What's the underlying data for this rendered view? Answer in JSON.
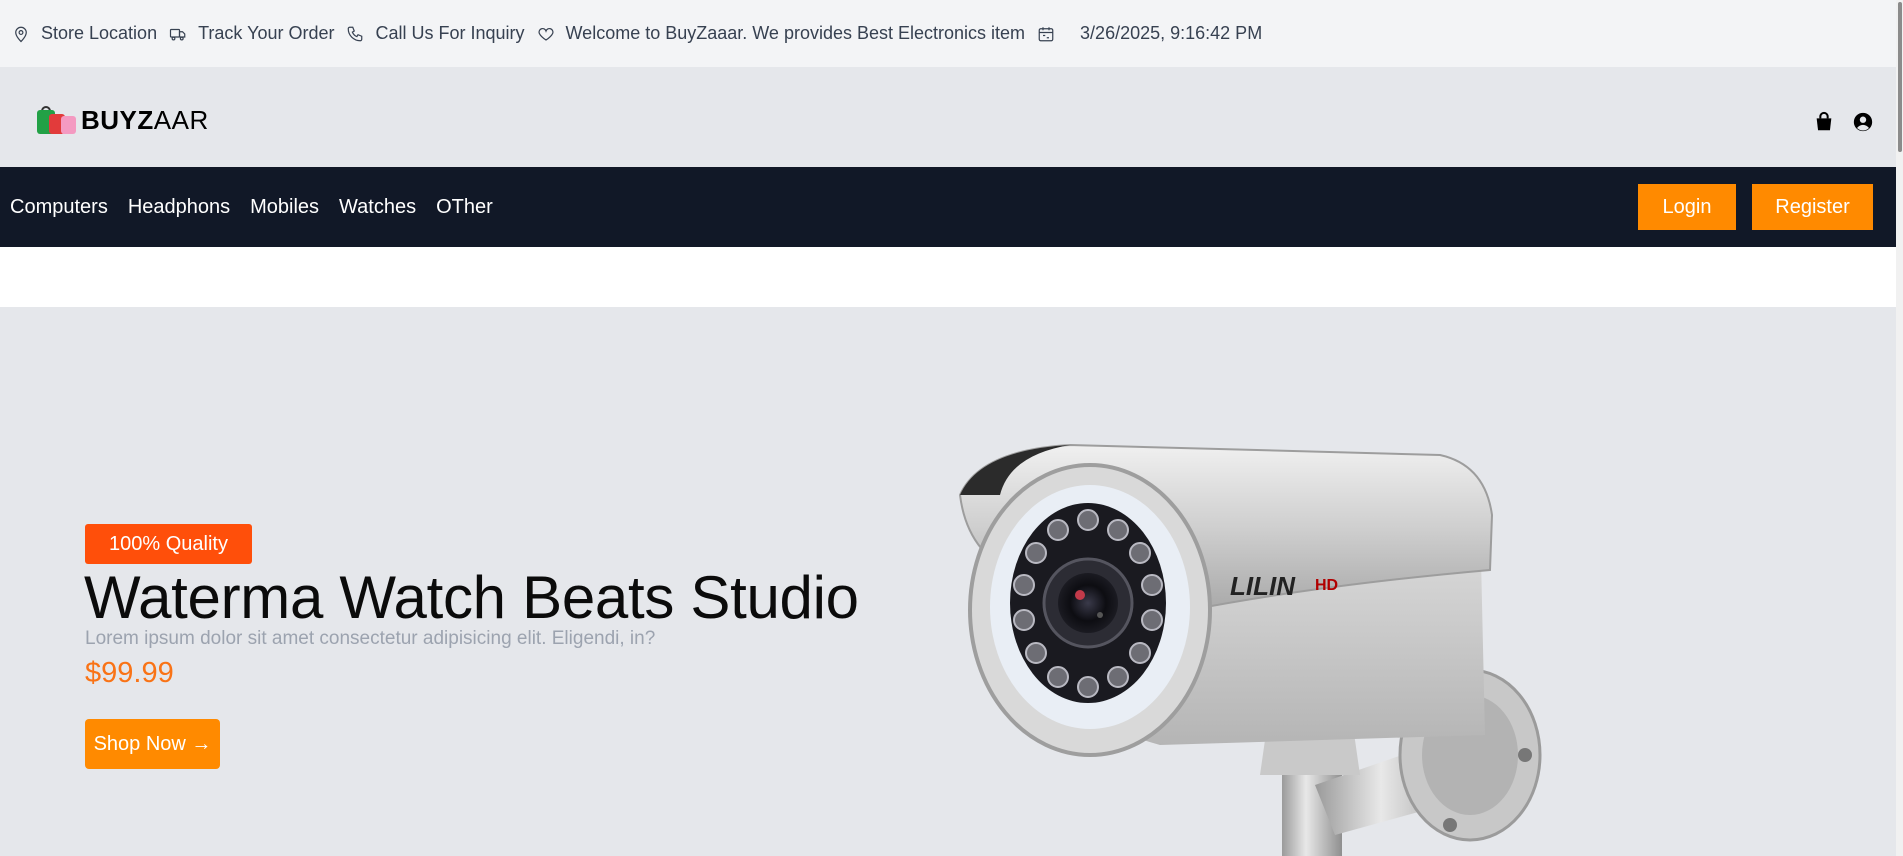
{
  "topbar": {
    "store_location": "Store Location",
    "track_order": "Track Your Order",
    "call_inquiry": "Call Us For Inquiry",
    "welcome": "Welcome to BuyZaaar. We provides Best Electronics item",
    "datetime": "3/26/2025, 9:16:42 PM"
  },
  "header": {
    "logo_bold": "BUYZ",
    "logo_rest": "AAR",
    "icons": [
      "shopping-bag-icon",
      "user-circle-icon"
    ]
  },
  "nav": {
    "links": [
      "Computers",
      "Headphons",
      "Mobiles",
      "Watches",
      "OTher"
    ],
    "login_label": "Login",
    "register_label": "Register"
  },
  "hero": {
    "badge": "100% Quality",
    "title": "Waterma Watch Beats Studio",
    "description": "Lorem ipsum dolor sit amet consectetur adipisicing elit. Eligendi, in?",
    "price": "$99.99",
    "shop_label": "Shop Now →",
    "camera_brand": "LILIN",
    "camera_model": "HD"
  },
  "colors": {
    "nav_bg": "#111827",
    "accent_orange": "#ff8a00",
    "badge_red_orange": "#ff4f0a",
    "price_orange": "#f97316"
  }
}
